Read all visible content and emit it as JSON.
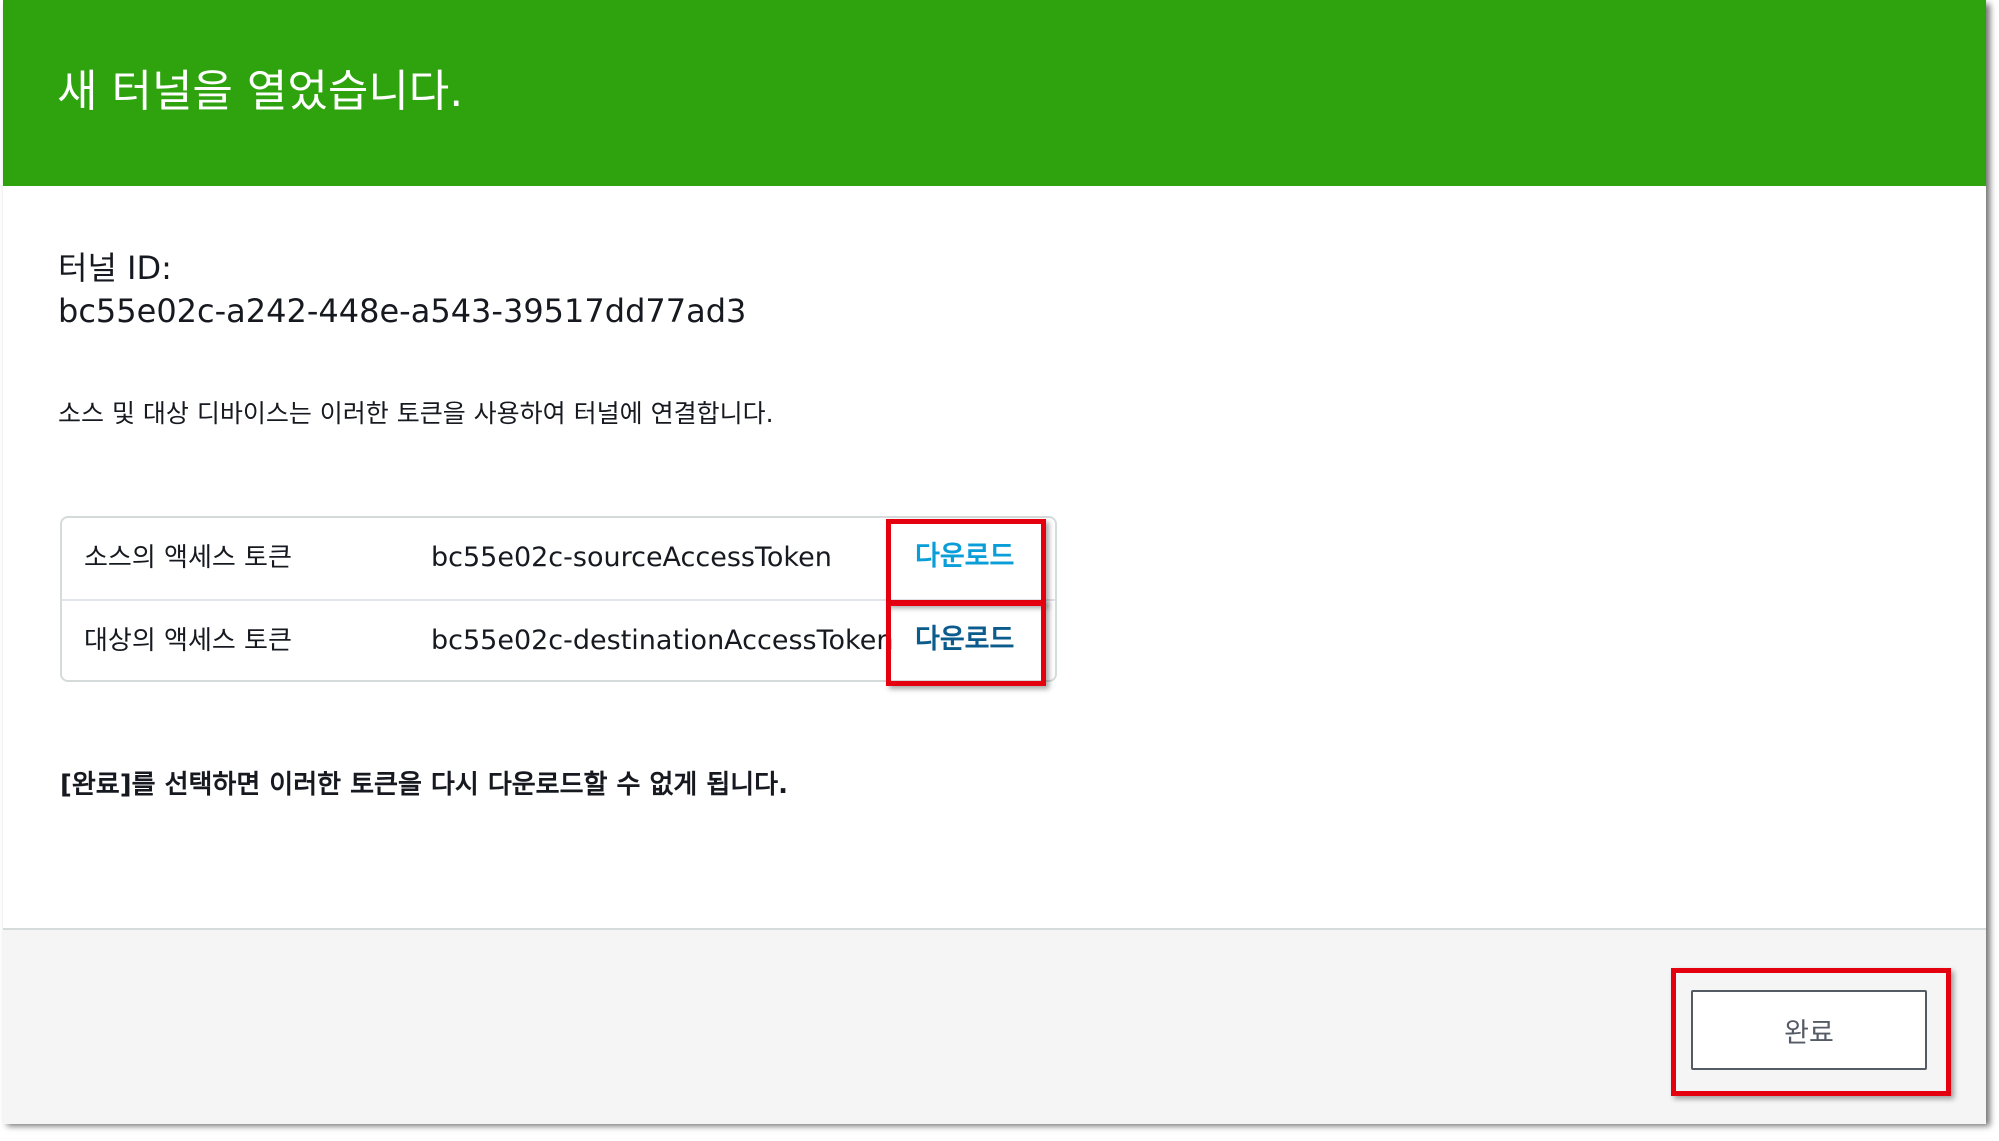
{
  "header": {
    "title": "새 터널을 열었습니다."
  },
  "tunnel": {
    "id_label": "터널 ID:",
    "id_value": "bc55e02c-a242-448e-a543-39517dd77ad3"
  },
  "description": "소스 및 대상 디바이스는 이러한 토큰을 사용하여 터널에 연결합니다.",
  "tokens": [
    {
      "name": "소스의 액세스 토큰",
      "file": "bc55e02c-sourceAccessToken",
      "action": "다운로드"
    },
    {
      "name": "대상의 액세스 토큰",
      "file": "bc55e02c-destinationAccessToken",
      "action": "다운로드"
    }
  ],
  "warning": "[완료]를 선택하면 이러한 토큰을 다시 다운로드할 수 없게 됩니다.",
  "footer": {
    "done_label": "완료"
  },
  "colors": {
    "header_bg": "#2ea30e",
    "link_primary": "#0a9ed8",
    "link_visited": "#0b5b8c",
    "highlight": "#e4000f"
  }
}
